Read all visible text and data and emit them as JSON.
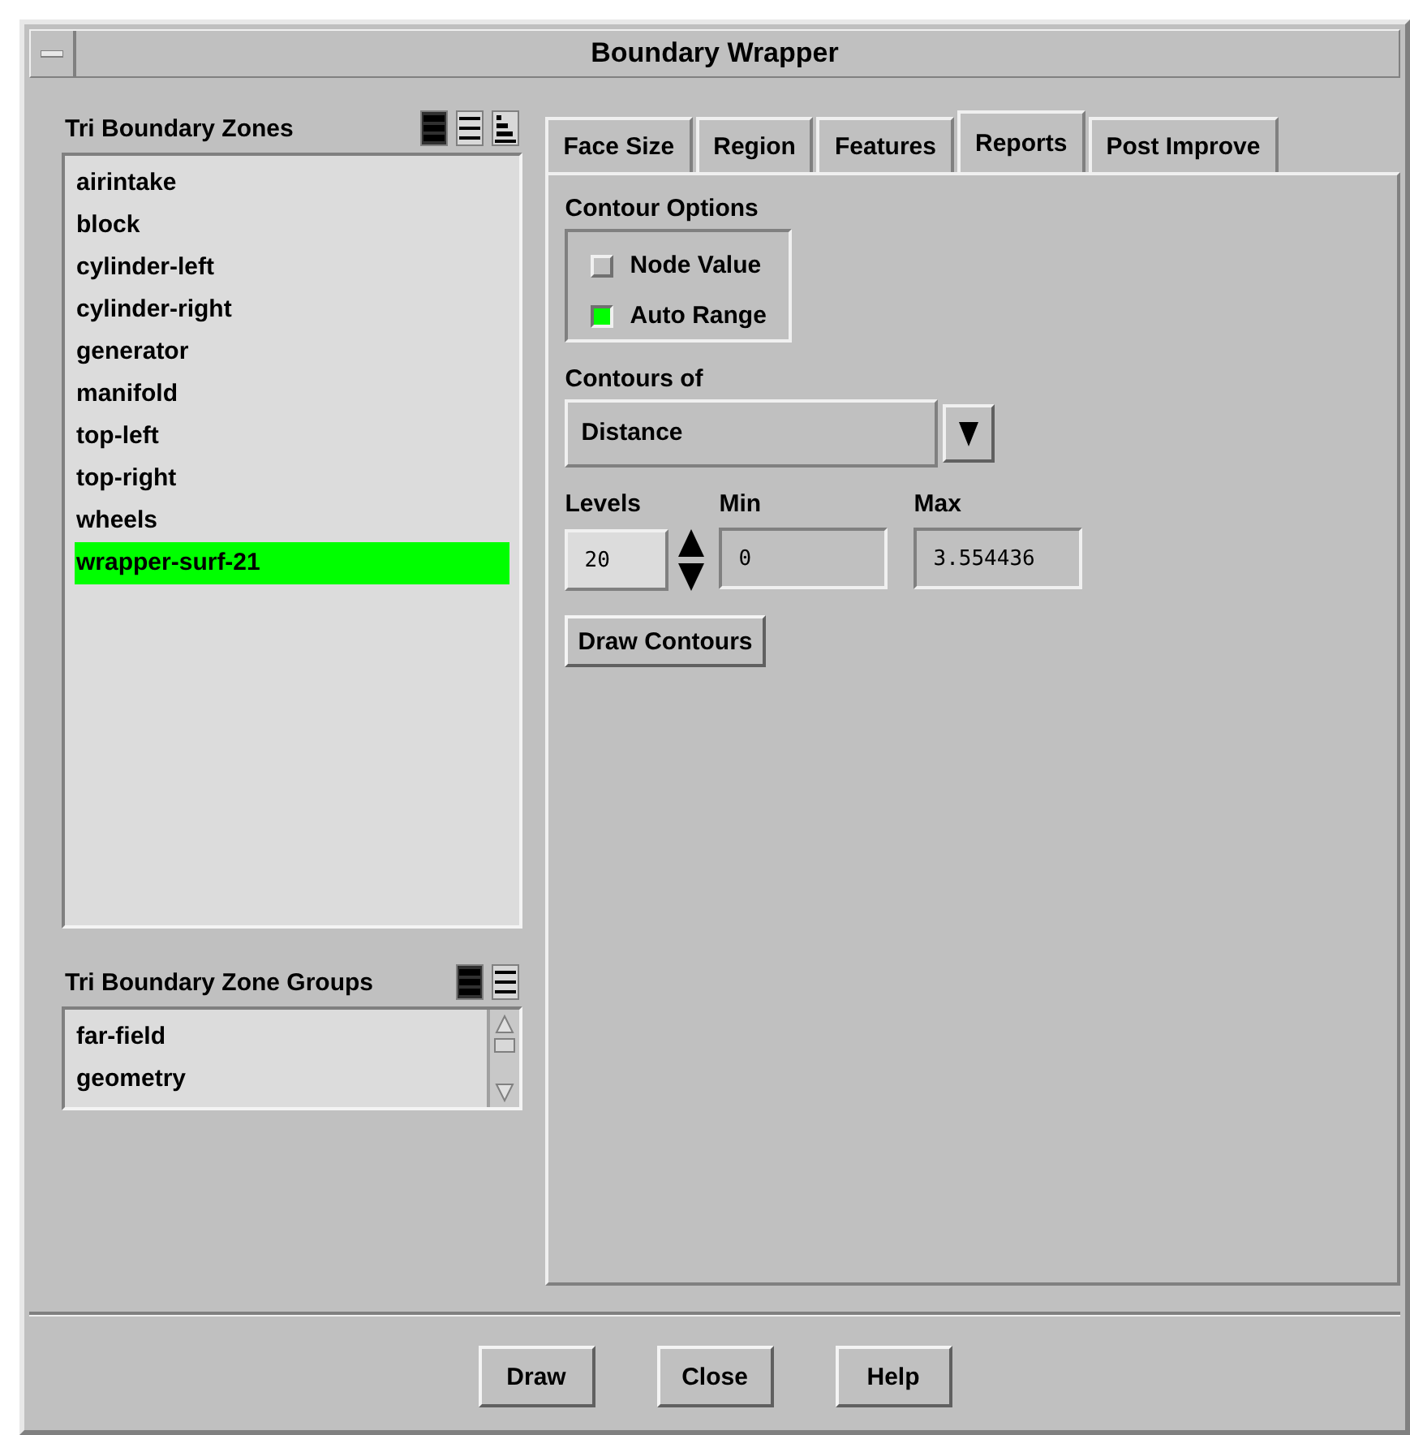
{
  "window": {
    "title": "Boundary Wrapper"
  },
  "zones": {
    "title": "Tri Boundary Zones",
    "items": [
      {
        "label": "airintake",
        "selected": false
      },
      {
        "label": "block",
        "selected": false
      },
      {
        "label": "cylinder-left",
        "selected": false
      },
      {
        "label": "cylinder-right",
        "selected": false
      },
      {
        "label": "generator",
        "selected": false
      },
      {
        "label": "manifold",
        "selected": false
      },
      {
        "label": "top-left",
        "selected": false
      },
      {
        "label": "top-right",
        "selected": false
      },
      {
        "label": "wheels",
        "selected": false
      },
      {
        "label": "wrapper-surf-21",
        "selected": true
      }
    ]
  },
  "groups": {
    "title": "Tri Boundary Zone Groups",
    "items": [
      {
        "label": "far-field",
        "selected": false
      },
      {
        "label": "geometry",
        "selected": false
      }
    ]
  },
  "tabs": [
    {
      "label": "Face Size",
      "selected": false
    },
    {
      "label": "Region",
      "selected": false
    },
    {
      "label": "Features",
      "selected": false
    },
    {
      "label": "Reports",
      "selected": true
    },
    {
      "label": "Post Improve",
      "selected": false
    }
  ],
  "contour_options": {
    "title": "Contour Options",
    "options": [
      {
        "label": "Node Value",
        "checked": false
      },
      {
        "label": "Auto Range",
        "checked": true
      }
    ]
  },
  "contours_of": {
    "label": "Contours of",
    "value": "Distance"
  },
  "levels": {
    "label": "Levels",
    "value": "20"
  },
  "min": {
    "label": "Min",
    "value": "0"
  },
  "max": {
    "label": "Max",
    "value": "3.554436"
  },
  "draw_contours": "Draw Contours",
  "buttons": [
    "Draw",
    "Close",
    "Help"
  ]
}
